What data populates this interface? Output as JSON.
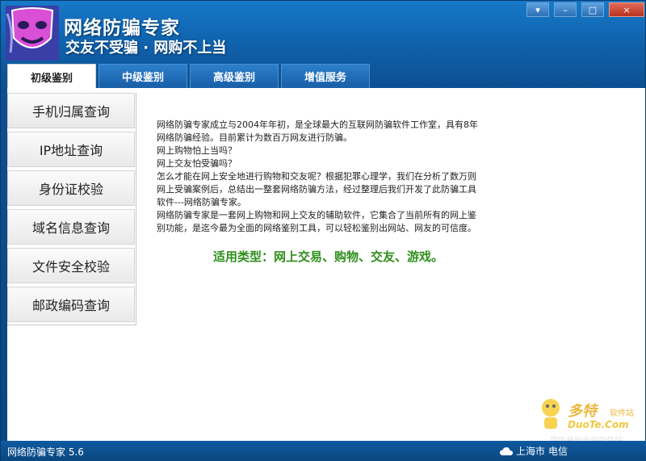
{
  "header": {
    "title": "网络防骗专家",
    "slogan": "交友不受骗 · 网购不上当",
    "logo_icon": "mask-icon"
  },
  "window_controls": {
    "dropdown": "▾",
    "minimize": "–",
    "maximize": "□",
    "close": "×"
  },
  "tabs": [
    {
      "label": "初级鉴别",
      "active": true
    },
    {
      "label": "中级鉴别",
      "active": false
    },
    {
      "label": "高级鉴别",
      "active": false
    },
    {
      "label": "增值服务",
      "active": false
    }
  ],
  "sidebar": {
    "items": [
      {
        "label": "手机归属查询"
      },
      {
        "label": "IP地址查询"
      },
      {
        "label": "身份证校验"
      },
      {
        "label": "域名信息查询"
      },
      {
        "label": "文件安全校验"
      },
      {
        "label": "邮政编码查询"
      }
    ]
  },
  "intro": {
    "lines": [
      "网络防骗专家成立与2004年年初，是全球最大的互联网防骗软件工作室，具有8年",
      "网络防骗经验。目前累计为数百万网友进行防骗。",
      "网上购物怕上当吗？",
      "网上交友怕受骗吗？",
      "怎么才能在网上安全地进行购物和交友呢？根据犯罪心理学，我们在分析了数万则",
      "网上受骗案例后，总结出一整套网络防骗方法，经过整理后我们开发了此防骗工具",
      "软件---网络防骗专家。",
      "网络防骗专家是一套网上购物和网上交友的辅助软件，它集合了当前所有的网上鉴",
      "别功能，是迄今最为全面的网络鉴别工具，可以轻松鉴别出网站、网友的可信度。"
    ],
    "usage": "适用类型：网上交易、购物、交友、游戏。"
  },
  "watermark": {
    "brand": "多特",
    "small": "软件站",
    "domain": "DuoTe.Com",
    "tag": "国内最安全的软件站"
  },
  "status": {
    "version": "网络防骗专家 5.6",
    "city": "上海市",
    "isp": "电信",
    "weather_icon": "cloud-icon"
  }
}
